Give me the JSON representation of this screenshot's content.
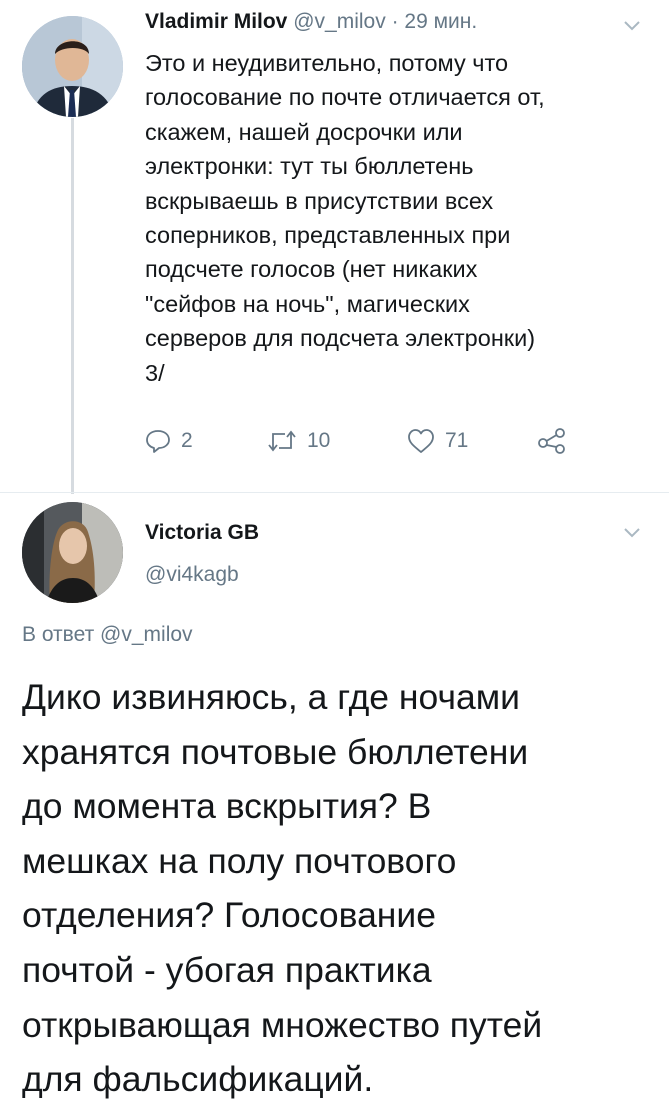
{
  "tweet1": {
    "author_name": "Vladimir Milov",
    "author_handle": "@v_milov",
    "separator": " · ",
    "timestamp": "29 мин.",
    "body_lines": [
      "Это и неудивительно, потому что",
      "голосование по почте отличается от,",
      "скажем, нашей досрочки или",
      "электронки: тут ты бюллетень",
      "вскрываешь в присутствии всех",
      "соперников, представленных при",
      "подсчете голосов (нет никаких",
      "\"сейфов на ночь\", магических",
      "серверов для подсчета электронки)",
      "3/"
    ],
    "actions": {
      "reply_count": "2",
      "retweet_count": "10",
      "like_count": "71"
    }
  },
  "tweet2": {
    "author_name": "Victoria GB",
    "author_handle": "@vi4kagb",
    "reply_prefix": "В ответ ",
    "reply_handle": "@v_milov",
    "body_lines": [
      "Дико извиняюсь, а где ночами",
      "хранятся почтовые бюллетени",
      "до момента вскрытия? В",
      "мешках на полу почтового",
      "отделения? Голосование",
      "почтой - убогая практика",
      "открывающая множество путей",
      "для фальсификаций."
    ]
  },
  "icons": {
    "reply": "reply-icon",
    "retweet": "retweet-icon",
    "like": "heart-icon",
    "share": "share-icon",
    "menu": "chevron-down-icon"
  },
  "colors": {
    "text": "#14171a",
    "secondary": "#657786",
    "thread_line": "#d6dbe0"
  }
}
